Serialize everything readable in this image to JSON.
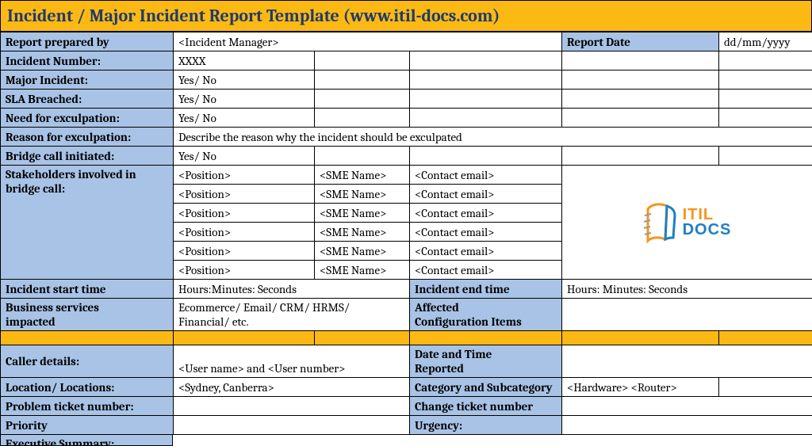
{
  "title": "Incident / Major Incident Report Template   (www.itil-docs.com)",
  "labels": {
    "preparedBy": "Report prepared by",
    "reportDate": "Report Date",
    "incidentNumber": "Incident Number:",
    "majorIncident": "Major Incident:",
    "slaBreached": "SLA Breached:",
    "needExculpation": "Need for exculpation:",
    "reasonExculpation": "Reason for exculpation:",
    "bridgeCall": "Bridge call initiated:",
    "stakeholders1": "Stakeholders involved in",
    "stakeholders2": "bridge call:",
    "incidentStart": "Incident start time",
    "incidentEnd": "Incident end time",
    "businessServices1": "Business services",
    "businessServices2": "impacted",
    "affectedCI1": "Affected",
    "affectedCI2": "Configuration Items",
    "callerDetails": "Caller details:",
    "dateTimeReported1": "Date and Time",
    "dateTimeReported2": "Reported",
    "locations": "Location/ Locations:",
    "categorySub": "Category and Subcategory",
    "problemTicket": "Problem ticket number:",
    "changeTicket": "Change ticket number",
    "priority": "Priority",
    "urgency": "Urgency:",
    "execSummary": "Executive Summary:"
  },
  "values": {
    "preparedBy": "<Incident Manager>",
    "reportDate": "dd/mm/yyyy",
    "incidentNumber": "XXXX",
    "majorIncident": "Yes/ No",
    "slaBreached": "Yes/ No",
    "needExculpation": "Yes/ No",
    "reasonExculpation": "Describe the reason why the incident should be exculpated",
    "bridgeCall": "Yes/ No",
    "incidentStart": "Hours:Minutes: Seconds",
    "incidentEnd": "Hours: Minutes: Seconds",
    "businessServices1": "Ecommerce/ Email/ CRM/ HRMS/",
    "businessServices2": "Financial/ etc.",
    "callerDetails": "<User name> and <User number>",
    "locations": "<Sydney, Canberra>",
    "categorySub": "<Hardware> <Router>"
  },
  "stakeholders": [
    {
      "pos": "<Position>",
      "sme": "<SME Name>",
      "email": "<Contact email>"
    },
    {
      "pos": "<Position>",
      "sme": "<SME Name>",
      "email": "<Contact email>"
    },
    {
      "pos": "<Position>",
      "sme": "<SME Name>",
      "email": "<Contact email>"
    },
    {
      "pos": "<Position>",
      "sme": "<SME Name>",
      "email": "<Contact email>"
    },
    {
      "pos": "<Position>",
      "sme": "<SME Name>",
      "email": "<Contact email>"
    },
    {
      "pos": "<Position>",
      "sme": "<SME Name>",
      "email": "<Contact email>"
    }
  ],
  "logo": {
    "line1": "ITIL",
    "line2": "DOCS"
  }
}
